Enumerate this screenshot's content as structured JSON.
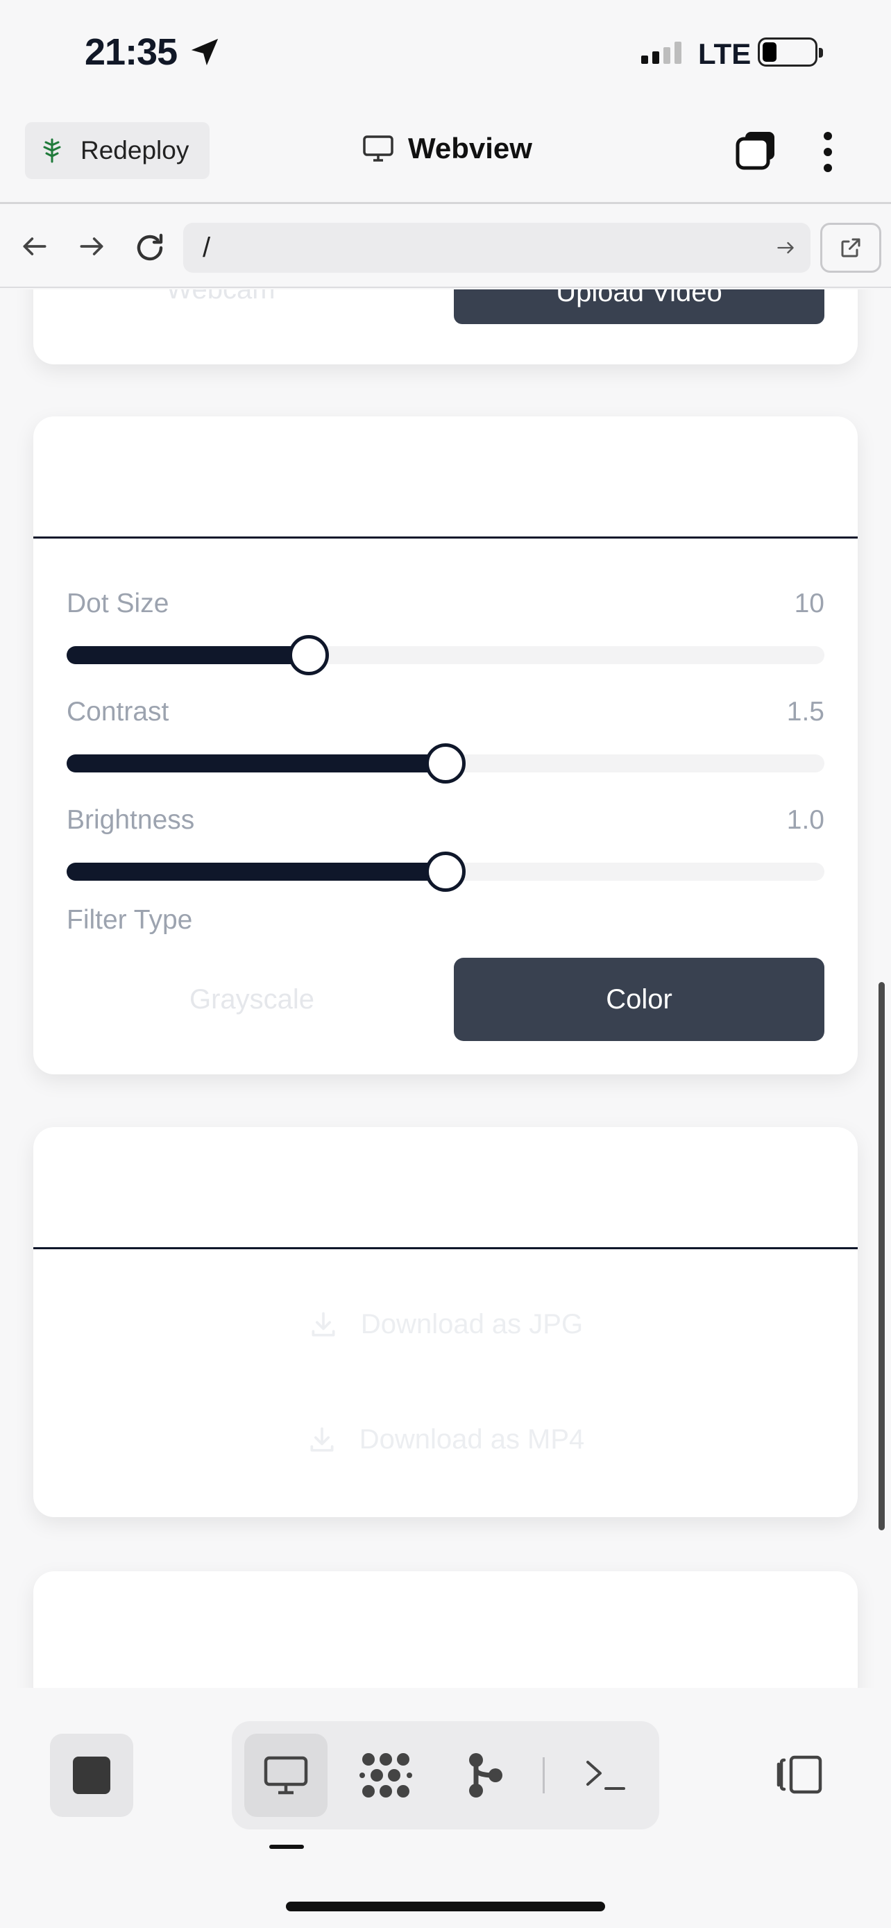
{
  "status_bar": {
    "time": "21:35",
    "network": "LTE"
  },
  "header": {
    "redeploy_label": "Redeploy",
    "title": "Webview"
  },
  "urlbar": {
    "url": "/"
  },
  "card_source": {
    "webcam_label": "Webcam",
    "upload_label": "Upload Video"
  },
  "controls": {
    "sliders": [
      {
        "label": "Dot Size",
        "value": "10",
        "fraction": 0.32
      },
      {
        "label": "Contrast",
        "value": "1.5",
        "fraction": 0.5
      },
      {
        "label": "Brightness",
        "value": "1.0",
        "fraction": 0.5
      }
    ],
    "filter_type_label": "Filter Type",
    "filter_options": [
      "Grayscale",
      "Color"
    ],
    "selected_filter": "Color"
  },
  "downloads": {
    "jpg_label": "Download as JPG",
    "mp4_label": "Download as MP4"
  },
  "toolbar": {
    "icons": [
      "stop-icon",
      "monitor-icon",
      "grid-icon",
      "branch-icon",
      "terminal-icon",
      "panel-toggle-icon"
    ]
  },
  "colors": {
    "accent": "#0f172a",
    "button_dark": "#394150"
  }
}
